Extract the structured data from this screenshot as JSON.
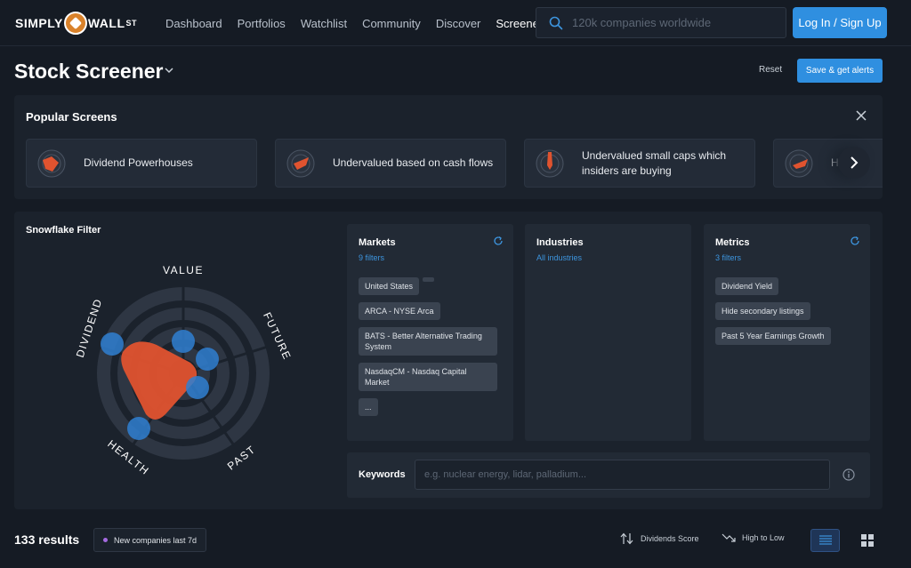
{
  "nav": {
    "logo_left": "SIMPLY",
    "logo_right": "WALL",
    "logo_sup": "ST",
    "links": [
      "Dashboard",
      "Portfolios",
      "Watchlist",
      "Community",
      "Discover",
      "Screener"
    ],
    "active_link": "Screener",
    "search_placeholder": "120k companies worldwide",
    "login_label": "Log In / Sign Up"
  },
  "header": {
    "title": "Stock Screener",
    "reset_label": "Reset",
    "save_label": "Save & get alerts"
  },
  "popular": {
    "title": "Popular Screens",
    "cards": [
      {
        "label": "Dividend Powerhouses",
        "icon": "dividend-gauge-icon"
      },
      {
        "label": "Undervalued based on cash flows",
        "icon": "value-gauge-icon"
      },
      {
        "label": "Undervalued small caps which insiders are buying",
        "icon": "insider-gauge-icon"
      },
      {
        "label": "Hi",
        "icon": "growth-gauge-icon"
      }
    ]
  },
  "snowflake": {
    "title": "Snowflake Filter",
    "axes": [
      "VALUE",
      "FUTURE",
      "PAST",
      "HEALTH",
      "DIVIDEND"
    ],
    "accent_color": "#e0532f",
    "handle_color": "#2f7fd1"
  },
  "markets": {
    "title": "Markets",
    "subtitle": "9 filters",
    "chips": [
      "United States",
      "ARCA - NYSE Arca",
      "BATS - Better Alternative Trading System",
      "NasdaqCM - Nasdaq Capital Market",
      "..."
    ]
  },
  "industries": {
    "title": "Industries",
    "subtitle": "All industries"
  },
  "metrics": {
    "title": "Metrics",
    "subtitle": "3 filters",
    "chips": [
      "Dividend Yield",
      "Hide secondary listings",
      "Past 5 Year Earnings Growth"
    ]
  },
  "keywords": {
    "label": "Keywords",
    "placeholder": "e.g. nuclear energy, lidar, palladium..."
  },
  "footer": {
    "results": "133 results",
    "badge": "New companies last 7d",
    "sort_by": "Dividends Score",
    "sort_order": "High to Low"
  }
}
